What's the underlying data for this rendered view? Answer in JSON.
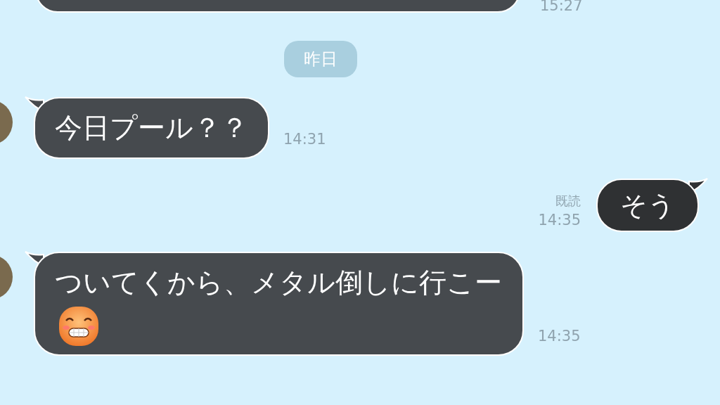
{
  "messages": [
    {
      "kind": "incoming",
      "partial": true,
      "time": "15:27"
    },
    {
      "kind": "date",
      "text": "昨日"
    },
    {
      "kind": "incoming",
      "text": "今日プール？？",
      "time": "14:31"
    },
    {
      "kind": "outgoing",
      "text": "そう",
      "read_label": "既読",
      "time": "14:35"
    },
    {
      "kind": "incoming",
      "text": "ついてくから、メタル倒しに行こー",
      "has_emoji": true,
      "time": "14:35"
    }
  ]
}
